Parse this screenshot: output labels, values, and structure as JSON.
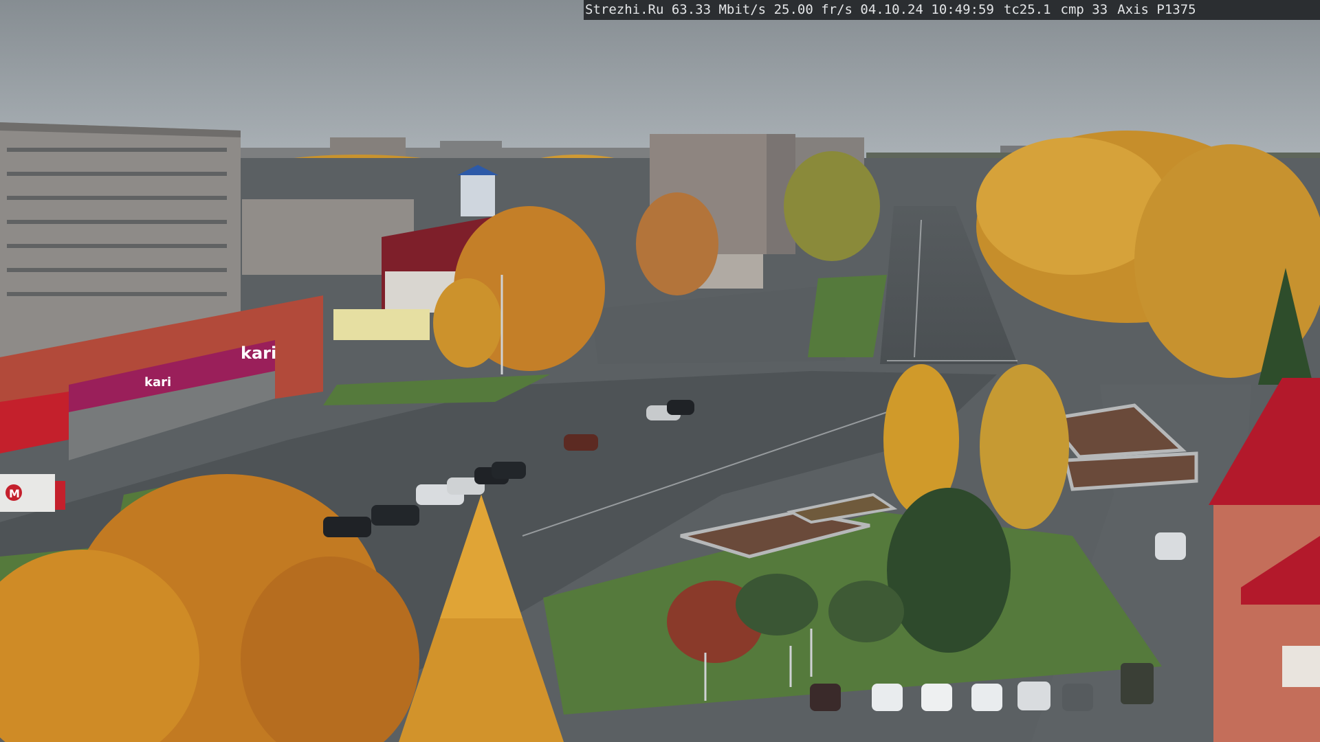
{
  "overlay": {
    "site": "Strezhi.Ru",
    "bitrate": "63.33 Mbit/s",
    "framerate": "25.00 fr/s",
    "date": "04.10.24",
    "time": "10:49:59",
    "tc": "tc25.1",
    "cmp": "cmp 33",
    "camera_model": "Axis P1375"
  },
  "signage": {
    "store_sign_1": "kari",
    "store_sign_2": "kari",
    "truck_logo": "M"
  },
  "colors": {
    "sky": "#9aa2a8",
    "foliage": "#d69a2c",
    "asphalt": "#4f5457",
    "grass": "#557a3c",
    "store_magenta": "#9a1f5a",
    "roof_red": "#b3192b"
  }
}
